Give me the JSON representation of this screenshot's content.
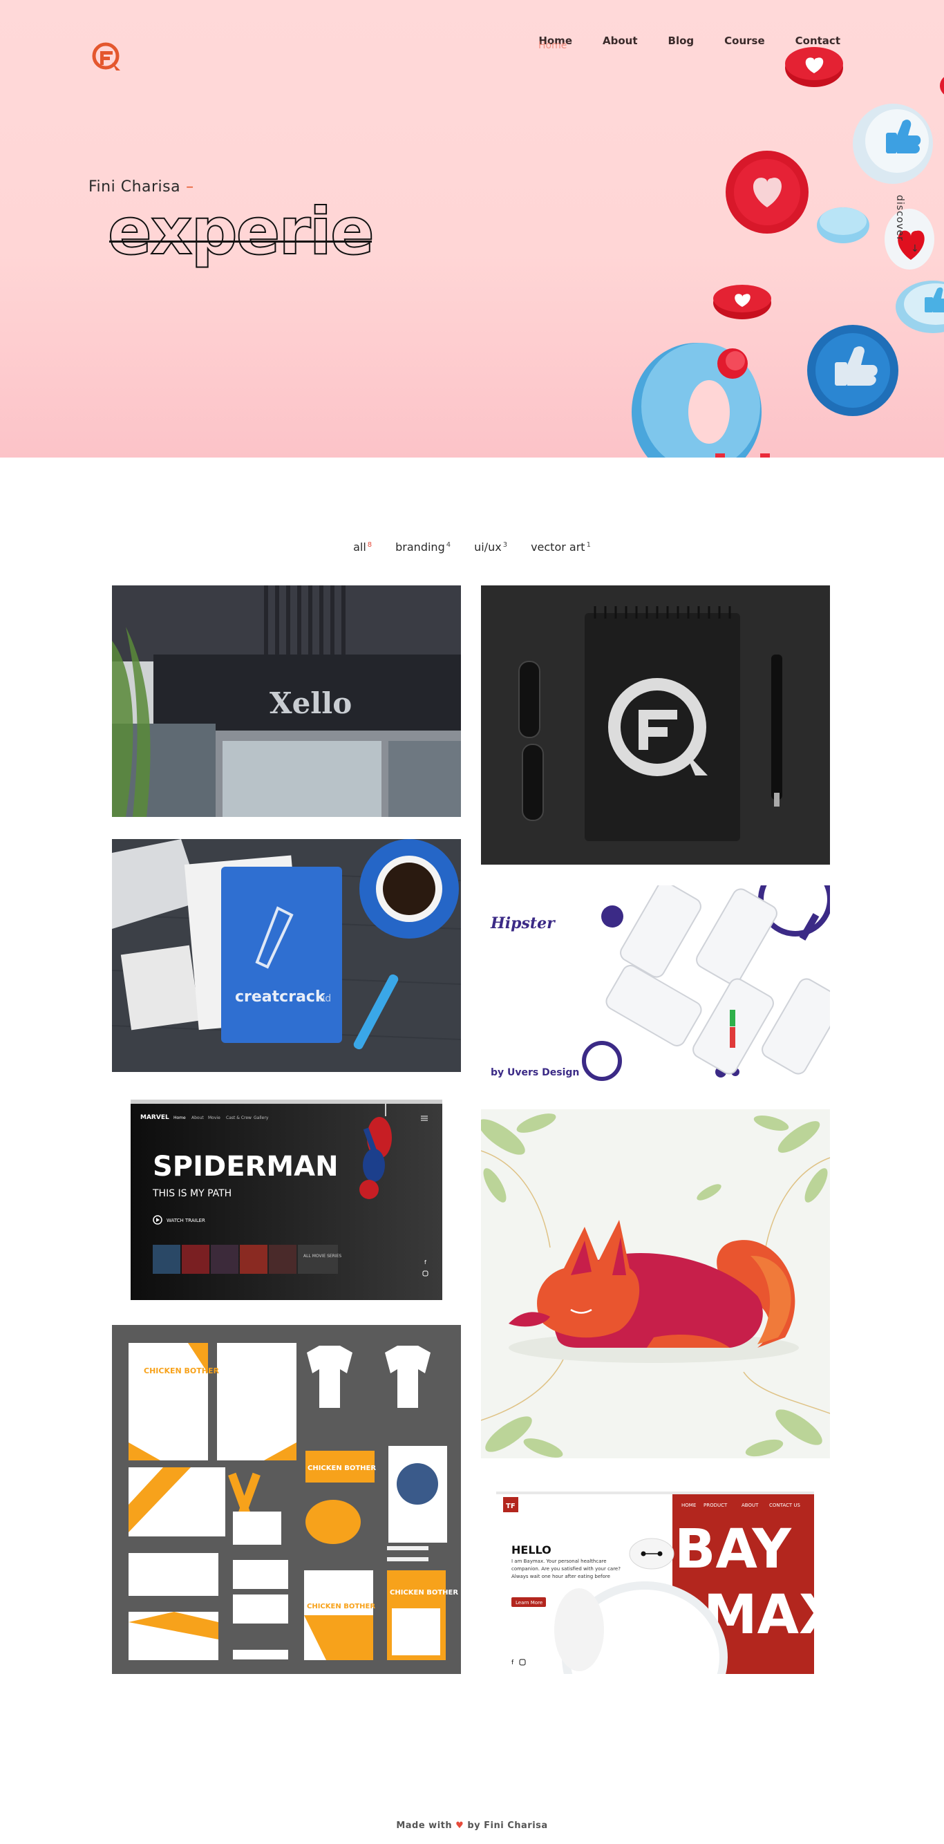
{
  "nav": {
    "items": [
      "Home",
      "About",
      "Blog",
      "Course",
      "Contact"
    ],
    "ghost_label": "Home"
  },
  "hero": {
    "name": "Fini Charisa",
    "dash": "–",
    "animated_word": "experie",
    "discover_label": "discover",
    "discover_arrow": "↓"
  },
  "filters": [
    {
      "label": "all",
      "count": "8"
    },
    {
      "label": "branding",
      "count": "4"
    },
    {
      "label": "ui/ux",
      "count": "3"
    },
    {
      "label": "vector art",
      "count": "1"
    }
  ],
  "portfolio": {
    "xello": {
      "sign": "Xello"
    },
    "notebook_logo": {},
    "creatcrack": {
      "brand": "creatcrack",
      "suffix": ".id"
    },
    "hipster": {
      "title": "Hipster",
      "byline": "by Uvers Design"
    },
    "spiderman": {
      "brand": "MARVEL",
      "menu": [
        "Home",
        "About",
        "Movie",
        "Cast & Crew",
        "Gallery"
      ],
      "headline": "SPIDERMAN",
      "tagline": "THIS IS MY PATH",
      "cta": "WATCH TRAILER",
      "more": "ALL MOVIE SERIES"
    },
    "fox": {},
    "chicken": {
      "brand": "CHICKEN BOTHER"
    },
    "baymax": {
      "menu": [
        "HOME",
        "PRODUCT",
        "ABOUT",
        "CONTACT US"
      ],
      "hello": "HELLO",
      "intro": "I am Baymax. Your personal healthcare companion. Are you satisfied with your care? Always wait one hour after eating before",
      "cta": "Learn More",
      "big1": "BAY",
      "big2": "MAX"
    }
  },
  "footer": {
    "pre": "Made with",
    "heart": "♥",
    "post": "by Fini Charisa"
  },
  "colors": {
    "accent": "#e65a2e",
    "hero_bg": "#ffd9d9"
  }
}
